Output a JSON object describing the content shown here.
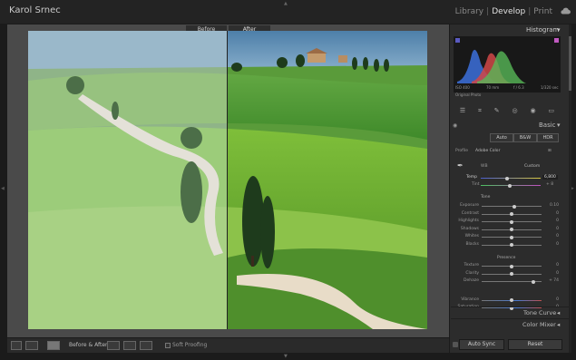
{
  "app": {
    "identity": "Karol Srnec",
    "modules": [
      "Library",
      "Develop",
      "Print"
    ],
    "active_module": "Develop"
  },
  "view": {
    "before_label": "Before",
    "after_label": "After"
  },
  "toolbar": {
    "view_mode_label": "Before & After",
    "soft_proofing": "Soft Proofing"
  },
  "histogram": {
    "title": "Histogram",
    "iso": "ISO 400",
    "focal": "70 mm",
    "aperture": "f / 6.3",
    "shutter": "1/320 sec",
    "original_photo": "Original Photo"
  },
  "basic": {
    "title": "Basic",
    "treatment_auto": "Auto",
    "treatment_bw": "B&W",
    "treatment_hdr": "HDR",
    "profile_label": "Profile",
    "profile_value": "Adobe Color",
    "wb_label": "WB",
    "wb_value": "Custom",
    "temp_label": "Temp",
    "temp_value": "6,800",
    "tint_label": "Tint",
    "tint_value": "+ 8",
    "tone_title": "Tone",
    "tone": [
      {
        "label": "Exposure",
        "value": "0.10",
        "pos": 0.55
      },
      {
        "label": "Contrast",
        "value": "0",
        "pos": 0.5
      },
      {
        "label": "Highlights",
        "value": "0",
        "pos": 0.5
      },
      {
        "label": "Shadows",
        "value": "0",
        "pos": 0.5
      },
      {
        "label": "Whites",
        "value": "0",
        "pos": 0.5
      },
      {
        "label": "Blacks",
        "value": "0",
        "pos": 0.5
      }
    ],
    "presence_title": "Presence",
    "presence": [
      {
        "label": "Texture",
        "value": "0",
        "pos": 0.5
      },
      {
        "label": "Clarity",
        "value": "0",
        "pos": 0.5
      },
      {
        "label": "Dehaze",
        "value": "+ 74",
        "pos": 0.87
      },
      {
        "label": "Vibrance",
        "value": "0",
        "pos": 0.5
      },
      {
        "label": "Saturation",
        "value": "0",
        "pos": 0.5
      }
    ]
  },
  "panels": {
    "tone_curve": "Tone Curve",
    "color_mixer": "Color Mixer"
  },
  "footer": {
    "auto_sync": "Auto Sync",
    "reset": "Reset"
  },
  "colors": {
    "accent": "#e0e0e0",
    "panel": "#2c2c2c",
    "background": "#1b1b1b"
  }
}
